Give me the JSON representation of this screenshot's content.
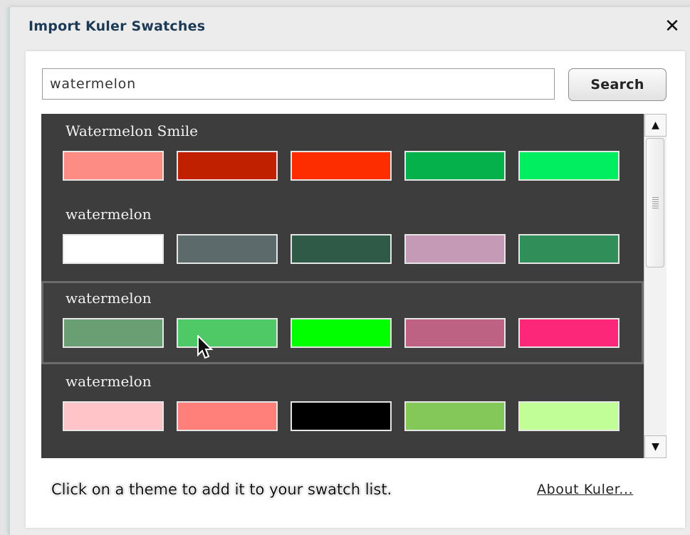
{
  "dialog": {
    "title": "Import Kuler Swatches",
    "close_icon": "close-icon",
    "search": {
      "value": "watermelon",
      "button_label": "Search"
    },
    "themes": [
      {
        "name": "Watermelon Smile",
        "colors": [
          "#fd8c85",
          "#c01f00",
          "#fe2d00",
          "#04b14a",
          "#00ee60"
        ]
      },
      {
        "name": "watermelon",
        "colors": [
          "#ffffff",
          "#5d6a6b",
          "#2f5a48",
          "#c49ab7",
          "#308f59"
        ]
      },
      {
        "name": "watermelon",
        "selected": true,
        "colors": [
          "#6a9e73",
          "#4fc966",
          "#02ff00",
          "#be6284",
          "#fd2779"
        ]
      },
      {
        "name": "watermelon",
        "colors": [
          "#ffc4c8",
          "#ff7f7a",
          "#000000",
          "#84c85a",
          "#c2fe97"
        ]
      }
    ],
    "hint_text": "Click on a theme to add it to your swatch list.",
    "about_link": "About Kuler..."
  },
  "colors": {
    "list_background": "#3d3d3d",
    "title_text": "#1c3a55"
  }
}
